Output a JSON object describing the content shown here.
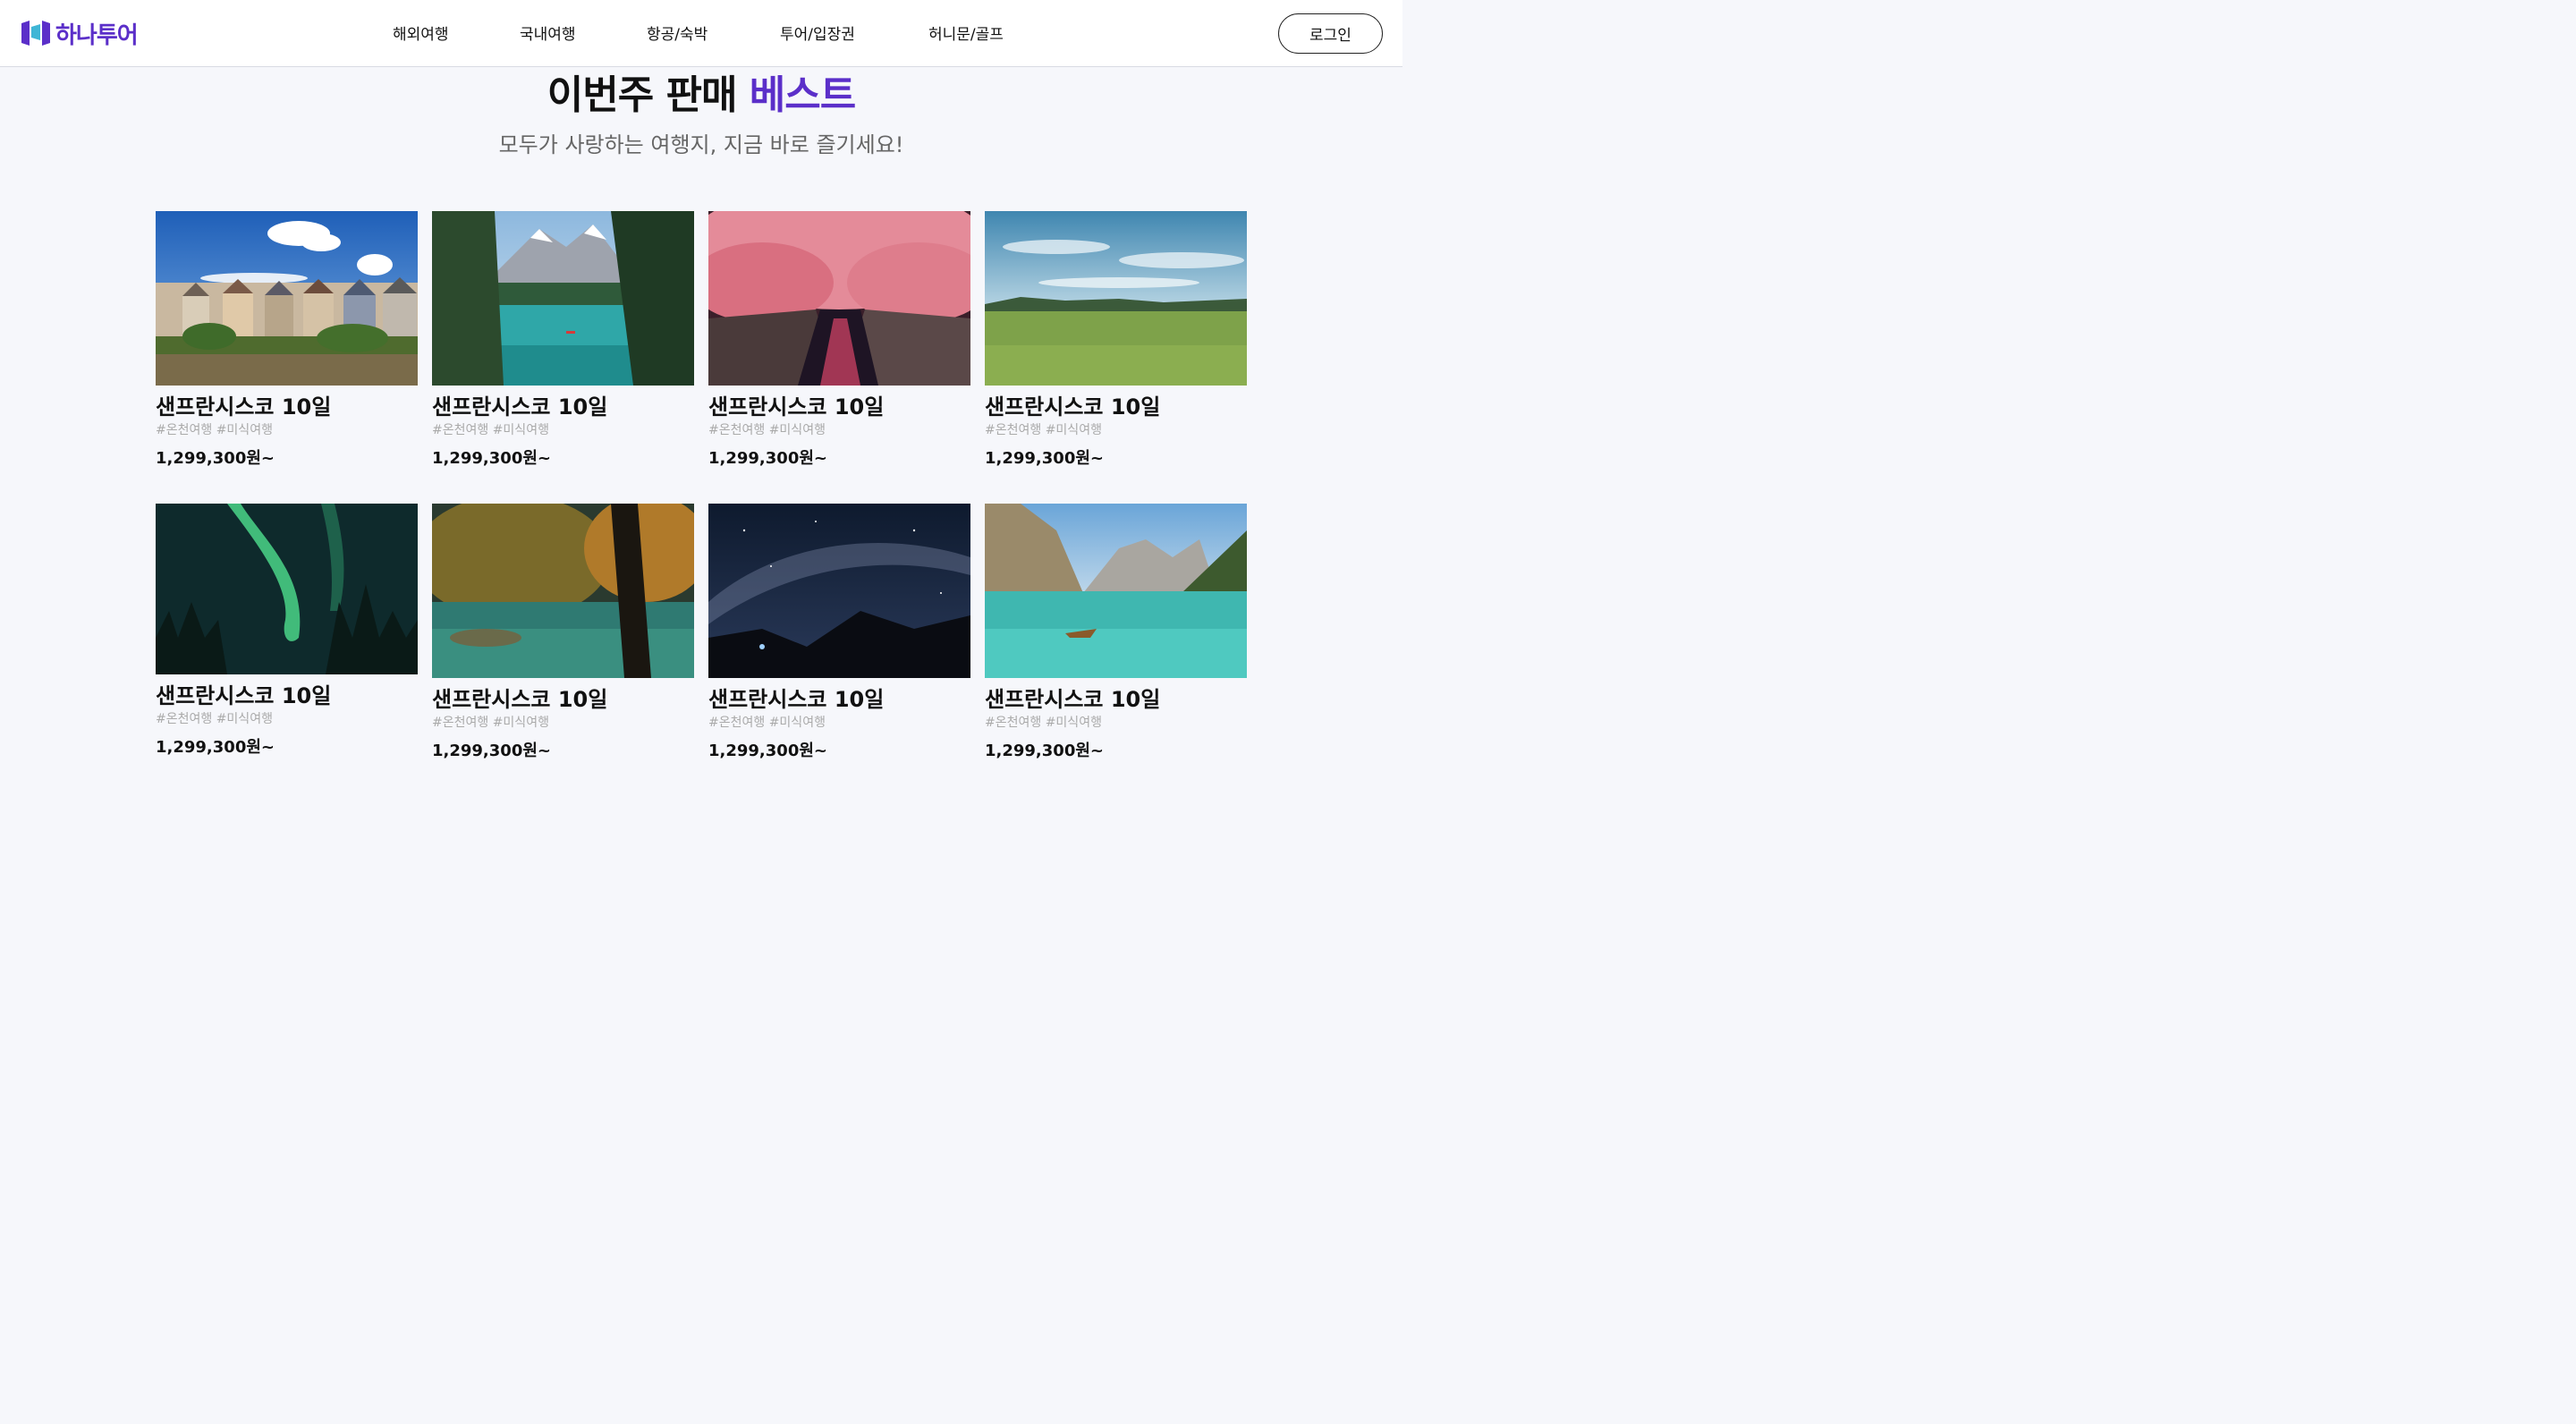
{
  "brand": {
    "name": "하나투어",
    "color": "#5b2fc9",
    "logo_icon": "hanatour-logo-icon"
  },
  "nav": {
    "items": [
      {
        "label": "해외여행"
      },
      {
        "label": "국내여행"
      },
      {
        "label": "항공/숙박"
      },
      {
        "label": "투어/입장권"
      },
      {
        "label": "허니문/골프"
      }
    ],
    "login_label": "로그인"
  },
  "section": {
    "title_main": "이번주 판매",
    "title_accent": "베스트",
    "subtitle": "모두가 사랑하는 여행지, 지금 바로 즐기세요!"
  },
  "products": [
    {
      "title": "샌프란시스코 10일",
      "tags": "#온천여행 #미식여행",
      "price": "1,299,300원~",
      "image": "san-francisco-painted-ladies"
    },
    {
      "title": "샌프란시스코 10일",
      "tags": "#온천여행 #미식여행",
      "price": "1,299,300원~",
      "image": "mountain-lake-forest"
    },
    {
      "title": "샌프란시스코 10일",
      "tags": "#온천여행 #미식여행",
      "price": "1,299,300원~",
      "image": "cherry-blossom-canal"
    },
    {
      "title": "샌프란시스코 10일",
      "tags": "#온천여행 #미식여행",
      "price": "1,299,300원~",
      "image": "green-meadow-sky"
    },
    {
      "title": "샌프란시스코 10일",
      "tags": "#온천여행 #미식여행",
      "price": "1,299,300원~",
      "image": "aurora-forest"
    },
    {
      "title": "샌프란시스코 10일",
      "tags": "#온천여행 #미식여행",
      "price": "1,299,300원~",
      "image": "autumn-lake"
    },
    {
      "title": "샌프란시스코 10일",
      "tags": "#온천여행 #미식여행",
      "price": "1,299,300원~",
      "image": "milky-way-mountains"
    },
    {
      "title": "샌프란시스코 10일",
      "tags": "#온천여행 #미식여행",
      "price": "1,299,300원~",
      "image": "alpine-lake-boat"
    }
  ]
}
